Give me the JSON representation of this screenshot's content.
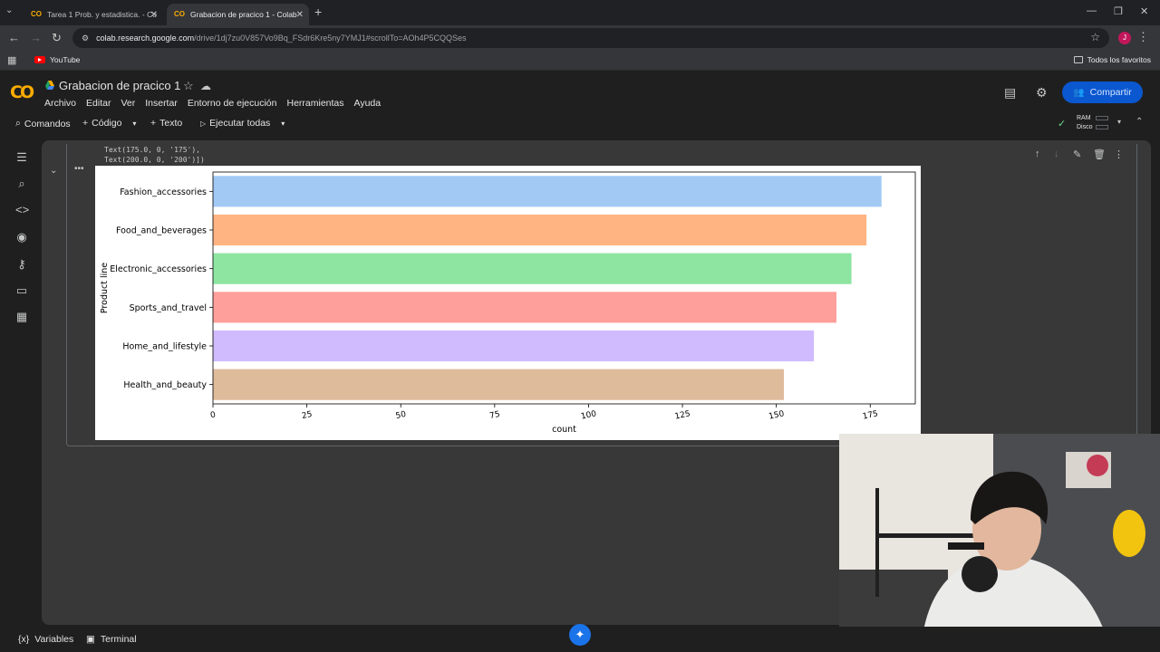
{
  "browser": {
    "tabs": [
      {
        "title": "Tarea 1 Prob. y estadistica. - Co",
        "active": false
      },
      {
        "title": "Grabacion de pracico 1 - Colab",
        "active": true
      }
    ],
    "url_host": "colab.research.google.com",
    "url_path": "/drive/1dj7zu0V857Vo9Bq_FSdr6Kre5ny7YMJ1#scrollTo=AOh4P5CQQSes",
    "profile_initial": "J",
    "bookmarks": [
      {
        "label": "YouTube"
      }
    ],
    "all_bookmarks_label": "Todos los favoritos"
  },
  "colab": {
    "doc_title": "Grabacion de pracico 1",
    "menu": [
      "Archivo",
      "Editar",
      "Ver",
      "Insertar",
      "Entorno de ejecución",
      "Herramientas",
      "Ayuda"
    ],
    "share_label": "Compartir",
    "toolbar": {
      "commands": "Comandos",
      "code": "Código",
      "text": "Texto",
      "run_all": "Ejecutar todas",
      "ram": "RAM",
      "disk": "Disco"
    },
    "output_text": [
      "Text(175.0, 0, '175'),",
      "Text(200.0, 0, '200')])"
    ],
    "statusbar": {
      "variables": "Variables",
      "terminal": "Terminal"
    }
  },
  "colors": {
    "accent_blue": "#0b57d0",
    "colab_orange": "#f9ab00",
    "status_green": "#6dd58c"
  },
  "chart_data": {
    "type": "bar",
    "orientation": "horizontal",
    "categories": [
      "Fashion_accessories",
      "Food_and_beverages",
      "Electronic_accessories",
      "Sports_and_travel",
      "Home_and_lifestyle",
      "Health_and_beauty"
    ],
    "values": [
      178,
      174,
      170,
      166,
      160,
      152
    ],
    "colors": [
      "#a1c9f4",
      "#ffb482",
      "#8de5a1",
      "#ff9f9b",
      "#d0bbff",
      "#debb9b"
    ],
    "xlabel": "count",
    "ylabel": "Product line",
    "xticks": [
      0,
      25,
      50,
      75,
      100,
      125,
      150,
      175
    ],
    "xlim": [
      0,
      187
    ],
    "grid": false
  }
}
